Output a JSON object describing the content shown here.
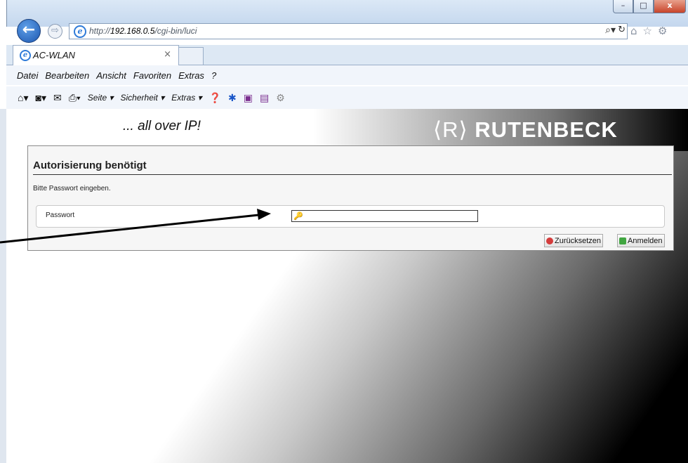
{
  "window": {
    "min": "–",
    "max": "□",
    "close": "x"
  },
  "nav": {
    "url_prefix": "http://",
    "url_host": "192.168.0.5",
    "url_path": "/cgi-bin/luci",
    "search_glyph": "⌕▾",
    "refresh_glyph": "↻",
    "right_icons": [
      "home-icon",
      "star-icon",
      "gear-icon"
    ]
  },
  "tab": {
    "title": "AC-WLAN",
    "close": "×"
  },
  "menu": [
    "Datei",
    "Bearbeiten",
    "Ansicht",
    "Favoriten",
    "Extras",
    "?"
  ],
  "commandbar": {
    "seite": "Seite ▾",
    "sicherheit": "Sicherheit ▾",
    "extras": "Extras ▾"
  },
  "page": {
    "slogan": "... all over IP!",
    "logo_text": "RUTENBECK",
    "logo_mark": "⟨R⟩",
    "title": "Autorisierung benötigt",
    "description": "Bitte Passwort eingeben.",
    "password_label": "Passwort",
    "password_value": "",
    "reset_label": "Zurücksetzen",
    "login_label": "Anmelden"
  }
}
